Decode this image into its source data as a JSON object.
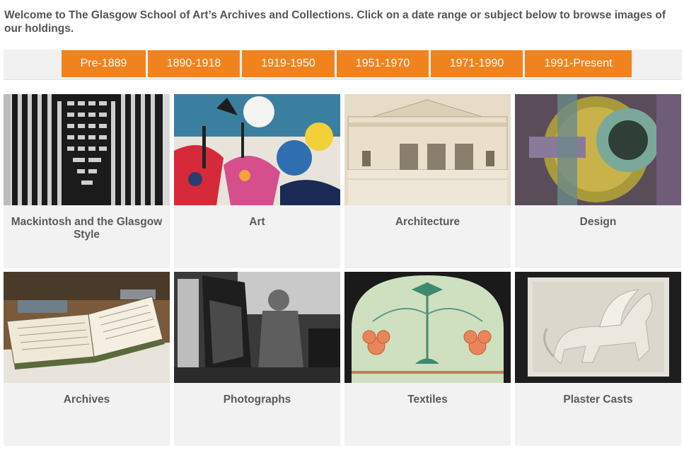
{
  "intro": "Welcome to The Glasgow School of Art’s Archives and Collections. Click on a date range or subject below to browse images of our holdings.",
  "date_ranges": [
    "Pre-1889",
    "1890-1918",
    "1919-1950",
    "1951-1970",
    "1971-1990",
    "1991-Present"
  ],
  "subjects": [
    {
      "label": "Mackintosh and the Glasgow Style",
      "image": "mackintosh-chair-image"
    },
    {
      "label": "Art",
      "image": "abstract-painting-image"
    },
    {
      "label": "Architecture",
      "image": "architectural-drawing-image"
    },
    {
      "label": "Design",
      "image": "design-artwork-image"
    },
    {
      "label": "Archives",
      "image": "open-ledger-image"
    },
    {
      "label": "Photographs",
      "image": "painter-photograph-image"
    },
    {
      "label": "Textiles",
      "image": "embroidered-textile-image"
    },
    {
      "label": "Plaster Casts",
      "image": "griffin-relief-image"
    }
  ],
  "colors": {
    "accent": "#f0831e",
    "tile_bg": "#f2f2f2",
    "text": "#555555"
  }
}
